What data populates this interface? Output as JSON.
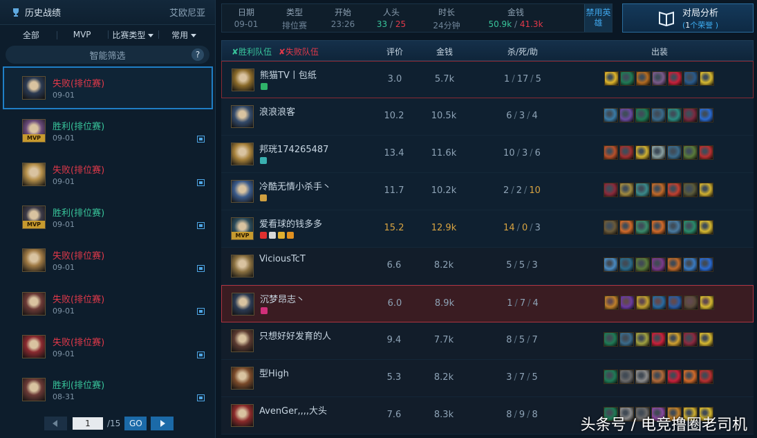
{
  "left_panel": {
    "title": "历史战绩",
    "region": "艾欧尼亚",
    "filters": [
      "全部",
      "MVP",
      "比赛类型",
      "常用"
    ],
    "smart_filter": "智能筛选",
    "help": "?",
    "matches": [
      {
        "result": "失败",
        "mode": "(排位赛)",
        "date": "09-01",
        "win": false,
        "mvp": false,
        "active": true,
        "hue": "#2b3a52"
      },
      {
        "result": "胜利",
        "mode": "(排位赛)",
        "date": "09-01",
        "win": true,
        "mvp": true,
        "active": false,
        "hue": "#6a4a7a"
      },
      {
        "result": "失败",
        "mode": "(排位赛)",
        "date": "09-01",
        "win": false,
        "mvp": false,
        "active": false,
        "hue": "#b5904b"
      },
      {
        "result": "胜利",
        "mode": "(排位赛)",
        "date": "09-01",
        "win": true,
        "mvp": true,
        "active": false,
        "hue": "#3c3a48"
      },
      {
        "result": "失败",
        "mode": "(排位赛)",
        "date": "09-01",
        "win": false,
        "mvp": false,
        "active": false,
        "hue": "#9f7a45"
      },
      {
        "result": "失败",
        "mode": "(排位赛)",
        "date": "09-01",
        "win": false,
        "mvp": false,
        "active": false,
        "hue": "#6b3a36"
      },
      {
        "result": "失败",
        "mode": "(排位赛)",
        "date": "09-01",
        "win": false,
        "mvp": false,
        "active": false,
        "hue": "#8a2a30"
      },
      {
        "result": "胜利",
        "mode": "(排位赛)",
        "date": "08-31",
        "win": true,
        "mvp": false,
        "active": false,
        "hue": "#6b3a36"
      }
    ],
    "pager": {
      "page": "1",
      "total": "/15",
      "go": "GO"
    }
  },
  "summary": {
    "labels": [
      "日期",
      "类型",
      "开始",
      "人头",
      "时长",
      "金钱"
    ],
    "date": "09-01",
    "type": "排位赛",
    "start": "23:26",
    "kills_win": "33",
    "kills_sep": "/",
    "kills_loss": "25",
    "duration": "24分钟",
    "gold_win": "50.9k",
    "gold_sep": "/",
    "gold_loss": "41.3k",
    "ban_label": "禁用英雄"
  },
  "analyze": {
    "title": "对局分析",
    "sub_prefix": "(",
    "sub_count": "1",
    "sub_suffix": "个荣誉 )"
  },
  "table_header": {
    "win_team": "胜利队伍",
    "loss_team": "失败队伍",
    "rating": "评价",
    "gold": "金钱",
    "kda": "杀/死/助",
    "items": "出装"
  },
  "players": [
    {
      "name": "熊猫TV丨包纸",
      "rating": "3.0",
      "gold": "5.7k",
      "k": "1",
      "d": "17",
      "a": "5",
      "team": "win",
      "highlight": "loss-top",
      "mvp": false,
      "hue": "#8a6a2a",
      "badges": [
        "#2fb36a"
      ],
      "items": [
        "#e0b52a",
        "#1f7a55",
        "#b36b20",
        "#7a5a8a",
        "#c8203a",
        "#2a5a8a",
        "#d6b830"
      ]
    },
    {
      "name": "浪浪浪客",
      "rating": "10.2",
      "gold": "10.5k",
      "k": "6",
      "d": "3",
      "a": "4",
      "team": "win",
      "mvp": false,
      "hue": "#334a6a",
      "badges": [],
      "items": [
        "#3a7aa5",
        "#6a4aa0",
        "#1f7a55",
        "#3a6a8a",
        "#2a8a80",
        "#7a2a40",
        "#2a6ad0"
      ]
    },
    {
      "name": "邦珖174265487",
      "rating": "13.4",
      "gold": "11.6k",
      "k": "10",
      "d": "3",
      "a": "6",
      "team": "win",
      "mvp": false,
      "hue": "#a5803a",
      "badges": [
        "#3ab0b0"
      ],
      "items": [
        "#b8502a",
        "#a03030",
        "#d0b030",
        "#8aa0a0",
        "#3a6a8a",
        "#5a7a3a",
        "#b83030"
      ]
    },
    {
      "name": "冷酷无情小杀手丶",
      "rating": "11.7",
      "gold": "10.2k",
      "k": "2",
      "d": "2",
      "a": "10",
      "team": "win",
      "mvp": false,
      "hue": "#3a5a8a",
      "badges": [
        "#d0a040"
      ],
      "items": [
        "#8a2a3a",
        "#a08a40",
        "#3a8a8a",
        "#c06a2a",
        "#c04030",
        "#5a5a3a",
        "#d0b030"
      ]
    },
    {
      "name": "爱看球的钱多多",
      "rating": "15.2",
      "gold": "12.9k",
      "k": "14",
      "d": "0",
      "a": "3",
      "team": "win",
      "mvp": true,
      "hue": "#2a4a5a",
      "badges": [
        "#e03030",
        "#d8d8d8",
        "#e0b030",
        "#e09020"
      ],
      "items": [
        "#6a5a3a",
        "#d06a2a",
        "#3a8a6a",
        "#d06a2a",
        "#4a7aa0",
        "#2a8a6a",
        "#d6b830"
      ]
    },
    {
      "name": "ViciousTcT",
      "rating": "6.6",
      "gold": "8.2k",
      "k": "5",
      "d": "5",
      "a": "3",
      "team": "loss",
      "mvp": false,
      "hue": "#8a7040",
      "badges": [],
      "items": [
        "#4a8ac0",
        "#2a6a8a",
        "#5a7a3a",
        "#7a3a8a",
        "#c06a2a",
        "#3a7ac0",
        "#2a6ad0"
      ]
    },
    {
      "name": "沉梦昂志丶",
      "rating": "6.0",
      "gold": "8.9k",
      "k": "1",
      "d": "7",
      "a": "4",
      "team": "loss",
      "highlight": "self",
      "mvp": false,
      "hue": "#2b3a52",
      "badges": [
        "#d0307a"
      ],
      "items": [
        "#c0802a",
        "#6a3aa0",
        "#c0a030",
        "#2a6aa0",
        "#2a5aa0",
        "#5a4a3a",
        "#d6b830"
      ]
    },
    {
      "name": "只想好好发育的人",
      "rating": "9.4",
      "gold": "7.7k",
      "k": "8",
      "d": "5",
      "a": "7",
      "team": "loss",
      "mvp": false,
      "hue": "#5a3a30",
      "badges": [],
      "items": [
        "#1f7a55",
        "#3a6a8a",
        "#a0a040",
        "#c8203a",
        "#d0a030",
        "#8a2a40",
        "#d6b830"
      ]
    },
    {
      "name": "型High",
      "rating": "5.3",
      "gold": "8.2k",
      "k": "3",
      "d": "7",
      "a": "5",
      "team": "loss",
      "mvp": false,
      "hue": "#7a4a2a",
      "badges": [],
      "items": [
        "#1f7a55",
        "#6a6a6a",
        "#8a8a8a",
        "#b06a3a",
        "#c8203a",
        "#d06a2a",
        "#b83030"
      ]
    },
    {
      "name": "AvenGer,,,,大头",
      "rating": "7.6",
      "gold": "8.3k",
      "k": "8",
      "d": "9",
      "a": "8",
      "team": "loss",
      "mvp": false,
      "hue": "#8a2a2a",
      "badges": [],
      "items": [
        "#1f7a55",
        "#8a8a8a",
        "#6a6a6a",
        "#8a4aa0",
        "#c0802a",
        "#d0b030",
        "#d6b830"
      ]
    }
  ],
  "watermark": "头条号 / 电竞撸圈老司机"
}
